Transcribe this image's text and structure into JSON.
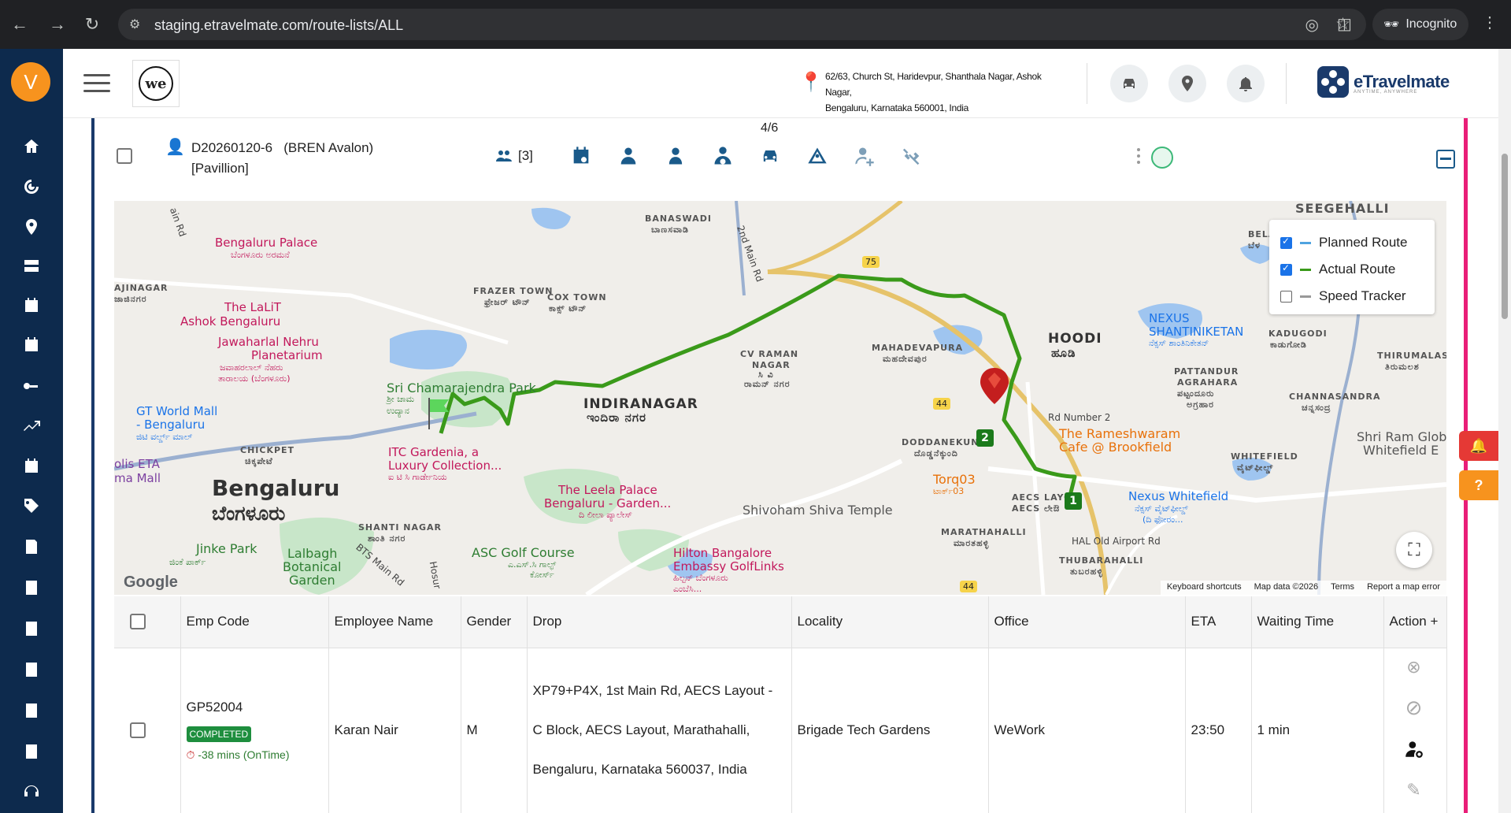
{
  "browser": {
    "url": "staging.etravelmate.com/route-lists/ALL",
    "incognito_label": "Incognito"
  },
  "sidebar": {
    "avatar_initial": "V",
    "items": [
      "home-icon",
      "dashboard-icon",
      "location-icon",
      "server-icon",
      "calendar-schedule-icon",
      "calendar-schedule-icon",
      "route-icon",
      "trend-icon",
      "calendar-icon",
      "tag-icon",
      "report-icon",
      "report-icon",
      "report-icon",
      "report-icon",
      "report-icon",
      "document-icon",
      "support-icon"
    ]
  },
  "header": {
    "address_line1": "62/63, Church St, Haridevpur, Shanthala Nagar, Ashok Nagar,",
    "address_line2": "Bengaluru, Karnataka 560001, India",
    "brand_name": "eTravelmate",
    "brand_tagline": "ANYTIME, ANYWHERE"
  },
  "route": {
    "counter": "4/6",
    "id": "D20260120-6",
    "vendor": "(BREN Avalon)",
    "site": "[Pavillion]",
    "team_count": "[3]"
  },
  "map": {
    "legend": [
      {
        "label": "Planned Route",
        "checked": true,
        "color": "#4fa3e0"
      },
      {
        "label": "Actual Route",
        "checked": true,
        "color": "#3a9a1a"
      },
      {
        "label": "Speed Tracker",
        "checked": false,
        "color": "#999999"
      }
    ],
    "labels": {
      "seegehalli": "SEEGEHALLI",
      "bengaluru_palace": "Bengaluru Palace",
      "bengaluru_palace_kn": "ಬೆಂಗಳೂರು ಅರಮನೆ",
      "banaswadi": "BANASWADI",
      "banaswadi_kn": "ಬಾಣಸವಾಡಿ",
      "lalit": "The LaLiT",
      "lalit2": "Ashok Bengaluru",
      "planetarium": "Jawaharlal Nehru",
      "planetarium2": "Planetarium",
      "planetarium_kn": "ಜವಾಹರಲಾಲ್ ನೆಹರು",
      "planetarium_kn2": "ತಾರಾಲಯ (ಬೆಂಗಳೂರು)",
      "frazer_town": "FRAZER TOWN",
      "frazer_town_kn": "ಫ್ರೇಜರ್ ಟೌನ್",
      "cox_town": "COX TOWN",
      "cox_town_kn": "ಕಾಕ್ಸ್ ಟೌನ್",
      "second_main": "2nd Main Rd",
      "cv_raman": "CV RAMAN",
      "cv_raman2": "NAGAR",
      "cv_raman_kn": "ಸಿ ವಿ",
      "cv_raman_kn2": "ರಾಮನ್ ನಗರ",
      "mahadevapura": "MAHADEVAPURA",
      "mahadevapura_kn": "ಮಹದೇವಪುರ",
      "hoodi": "HOODI",
      "hoodi_kn": "ಹೂಡಿ",
      "nexus_shanti": "NEXUS",
      "nexus_shanti2": "SHANTINIKETAN",
      "nexus_shanti_kn": "ನೆಕ್ಸಸ್ ಶಾಂತಿನಿಕೇತನ್",
      "kadugodi": "KADUGODI",
      "kadugodi_kn": "ಕಾಡುಗೋಡಿ",
      "thirumalashe": "THIRUMALASH",
      "thirumalashe_kn": "ತಿರುಮಲಶ",
      "pattandur": "PATTANDUR",
      "pattandur2": "AGRAHARA",
      "pattandur_kn": "ಪಟ್ಟಂದೂರು",
      "pattandur_kn2": "ಅಗ್ರಹಾರ",
      "channasandra": "CHANNASANDRA",
      "channasandra_kn": "ಚನ್ನಸಂದ್ರ",
      "ajinagar": "AJINAGAR",
      "ajinagar_kn": "ಜಾಜಿನಗರ",
      "sri_cham": "Sri Chamarajendra Park",
      "sri_cham_kn": "ಶ್ರೀ ಚಾಮ",
      "sri_cham_kn2": "ಉದ್ಯಾನ",
      "indiranagar": "INDIRANAGAR",
      "indiranagar_kn": "ಇಂದಿರಾ ನಗರ",
      "gt_world": "GT World Mall",
      "gt_world2": "- Bengaluru",
      "gt_world_kn": "ಜಿಟಿ ವರ್ಲ್ಡ್ ಮಾಲ್",
      "chickpet": "CHICKPET",
      "chickpet_kn": "ಚಿಕ್ಕಪೇಟೆ",
      "itc": "ITC Gardenia, a",
      "itc2": "Luxury Collection...",
      "itc_kn": "ಐ ಟಿ ಸಿ ಗಾರ್ಡೇನಿಯ",
      "etal": "olis ETA",
      "etal2": "ma Mall",
      "bengaluru": "Bengaluru",
      "bengaluru_kn": "ಬೆಂಗಳೂರು",
      "leela": "The Leela Palace",
      "leela2": "Bengaluru - Garden...",
      "leela_kn": "ದಿ ಲೀಲಾ ಪ್ಯಾಲೇಸ್",
      "shivoham": "Shivoham Shiva Temple",
      "rd_number2": "Rd Number 2",
      "rameshwaram": "The Rameshwaram",
      "rameshwaram2": "Cafe @ Brookfield",
      "doddanekundi": "DODDANEKUNDI",
      "doddanekundi_kn": "ದೊಡ್ಡನೆಕ್ಕುಂದಿ",
      "torq": "Torq03",
      "torq_kn": "ಟಾರ್ಕ್03",
      "aecs": "AECS LAYOU",
      "aecs_kn": "AECS ಲೇಔ",
      "whitefield": "WHITEFIELD",
      "whitefield_kn": "ವೈಟ್‌ಫೀಲ್ಡ್",
      "sri_ram": "Shri Ram Glob",
      "sri_ram2": "Whitefield E",
      "nexus_wf": "Nexus Whitefield",
      "nexus_wf_kn": "ನೆಕ್ಸಸ್ ವೈಟ್‌ಫೀಲ್ಡ್",
      "nexus_wf_kn2": "(ದಿ ಫೋರಂ...",
      "shanti_nagar": "SHANTI NAGAR",
      "shanti_nagar_kn": "ಶಾಂತಿ ನಗರ",
      "jinke": "Jinke Park",
      "jinke_kn": "ಜಿಂಕೆ ಪಾರ್ಕ್",
      "lalbagh": "Lalbagh",
      "lalbagh2": "Botanical",
      "lalbagh3": "Garden",
      "bts": "BTS Main Rd",
      "hosur": "Hosur",
      "asc_golf": "ASC Golf Course",
      "asc_golf_kn": "ಎ.ಎಸ್.ಸಿ ಗಾಲ್ಫ್",
      "asc_golf_kn2": "ಕೋರ್ಸ್",
      "hilton": "Hilton Bangalore",
      "hilton2": "Embassy GolfLinks",
      "hilton_kn": "ಹಿಲ್ಟನ್ ಬೆಂಗಳೂರು",
      "hilton_kn2": "ಎಂಬೆಸಿ...",
      "marathahalli": "MARATHAHALLI",
      "marathahalli_kn": "ಮಾರತಹಳ್ಳಿ",
      "hal_road": "HAL Old Airport Rd",
      "thubarahalli": "THUBARAHALLI",
      "thubarahalli_kn": "ತುಬರಹಳ್ಳಿ",
      "bela": "BELA",
      "bela_kn": "ಬೆಳ",
      "ain_rd": "ain Rd",
      "road_75": "75",
      "road_44a": "44",
      "road_44b": "44",
      "marker_1": "1",
      "marker_2": "2",
      "google": "Google",
      "footer_shortcuts": "Keyboard shortcuts",
      "footer_data": "Map data ©2026",
      "footer_terms": "Terms",
      "footer_report": "Report a map error"
    }
  },
  "table": {
    "headers": [
      "Emp Code",
      "Employee Name",
      "Gender",
      "Drop",
      "Locality",
      "Office",
      "ETA",
      "Waiting Time",
      "Action +"
    ],
    "rows": [
      {
        "emp_code": "GP52004",
        "status": "COMPLETED",
        "ontime": "-38 mins (OnTime)",
        "name": "Karan Nair",
        "gender": "M",
        "drop": "XP79+P4X, 1st Main Rd, AECS Layout - C Block, AECS Layout, Marathahalli, Bengaluru, Karnataka 560037, India",
        "locality": "Brigade Tech Gardens",
        "office": "WeWork",
        "eta": "23:50",
        "waiting": "1 min"
      }
    ]
  },
  "colors": {
    "sidebar_bg": "#0d2a4d",
    "accent_orange": "#f7931e",
    "actual_route": "#3a9a1a",
    "completed_badge": "#1e8e3e",
    "right_border": "#e91e78"
  }
}
